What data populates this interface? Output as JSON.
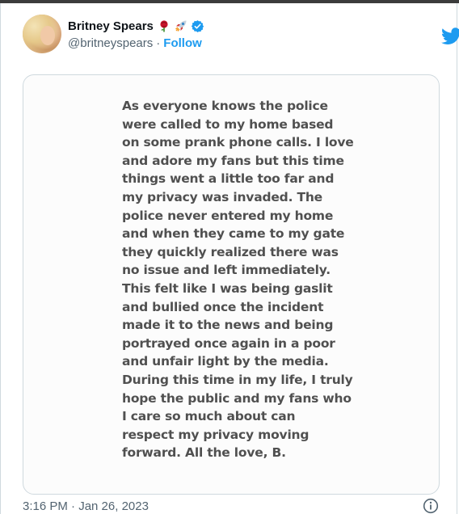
{
  "tweet": {
    "author": {
      "display_name": "Britney Spears",
      "handle": "@britneyspears",
      "separator": "·",
      "follow_label": "Follow",
      "emojis": [
        "rose-emoji",
        "rocket-emoji"
      ],
      "verified": true
    },
    "note_lines": [
      "As everyone knows the police",
      "were called to my home based",
      "on some prank phone calls. I love",
      "and adore my fans but this time",
      "things went a little too far and",
      "my privacy was invaded. The",
      "police never entered my home",
      "and when they came to my gate",
      "they quickly realized there was",
      "no issue and left immediately.",
      "This felt like I was being gaslit",
      "and bullied once the incident",
      "made it to the news and being",
      "portrayed once again in a poor",
      "and unfair light by the media.",
      "During this time in my life, I truly",
      "hope the public and my fans who",
      "I care so much about can",
      "respect my privacy moving",
      "forward. All the love, B."
    ],
    "timestamp": "3:16 PM · Jan 26, 2023"
  },
  "colors": {
    "accent": "#1d9bf0",
    "name_text": "#0f1419",
    "secondary_text": "#536471",
    "note_text": "#505050",
    "border": "#cfd9de"
  },
  "icons": {
    "brand": "twitter-bird-icon",
    "verified": "verified-badge-icon",
    "info": "info-icon"
  }
}
